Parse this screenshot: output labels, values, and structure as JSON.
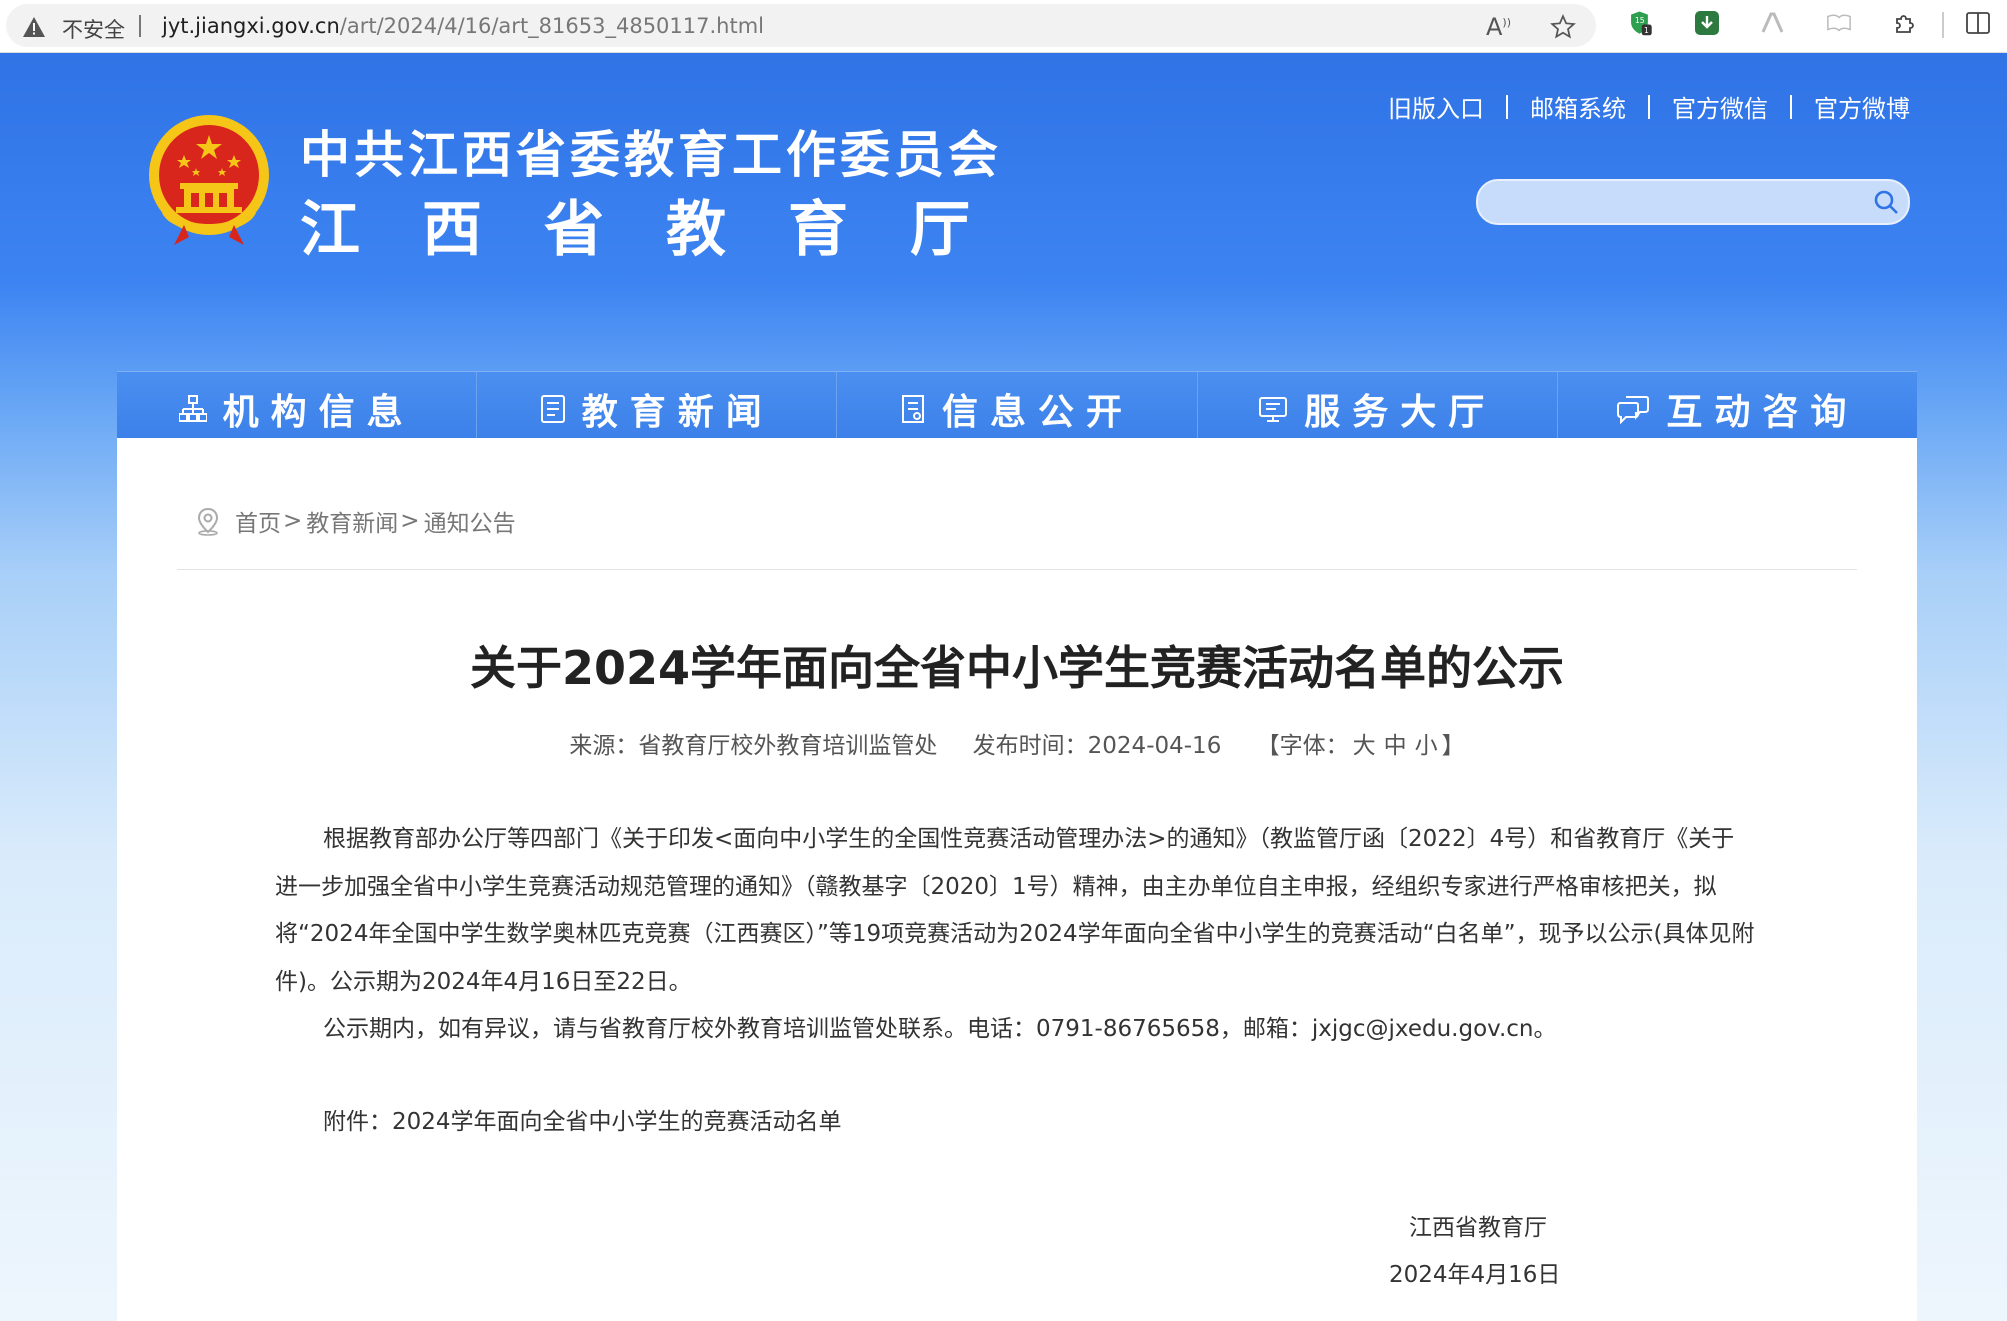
{
  "browser": {
    "insecure_label": "不安全",
    "url_host": "jyt.jiangxi.gov.cn",
    "url_path": "/art/2024/4/16/art_81653_4850117.html",
    "extension_badge": "1"
  },
  "header": {
    "title_line1": "中共江西省委教育工作委员会",
    "title_line2": "江西省教育厅",
    "top_links": [
      "旧版入口",
      "邮箱系统",
      "官方微信",
      "官方微博"
    ],
    "search_placeholder": ""
  },
  "nav": {
    "items": [
      "机构信息",
      "教育新闻",
      "信息公开",
      "服务大厅",
      "互动咨询"
    ]
  },
  "breadcrumb": {
    "home": "首页",
    "level1": "教育新闻",
    "level2": "通知公告",
    "separator": ">"
  },
  "article": {
    "title": "关于2024学年面向全省中小学生竞赛活动名单的公示",
    "source": "来源：省教育厅校外教育培训监管处",
    "publish_time": "发布时间：2024-04-16",
    "font_prefix": "【字体：",
    "font_large": "大",
    "font_medium": "中",
    "font_small": "小",
    "font_suffix": "】",
    "paragraph1": "根据教育部办公厅等四部门《关于印发<面向中小学生的全国性竞赛活动管理办法>的通知》（教监管厅函〔2022〕4号）和省教育厅《关于进一步加强全省中小学生竞赛活动规范管理的通知》（赣教基字〔2020〕1号）精神，由主办单位自主申报，经组织专家进行严格审核把关，拟将“2024年全国中学生数学奥林匹克竞赛（江西赛区）”等19项竞赛活动为2024学年面向全省中小学生的竞赛活动“白名单”，现予以公示(具体见附件)。公示期为2024年4月16日至22日。",
    "paragraph2": "公示期内，如有异议，请与省教育厅校外教育培训监管处联系。电话：0791-86765658，邮箱：jxjgc@jxedu.gov.cn。",
    "attachment_label": "附件：",
    "attachment_link": "2024学年面向全省中小学生的竞赛活动名单",
    "sign_org": "江西省教育厅",
    "sign_date": "2024年4月16日"
  },
  "colors": {
    "header_blue": "#2f73e6",
    "nav_blue": "#3a7fe9",
    "emblem_red": "#d9261c",
    "emblem_gold": "#f5c518"
  }
}
